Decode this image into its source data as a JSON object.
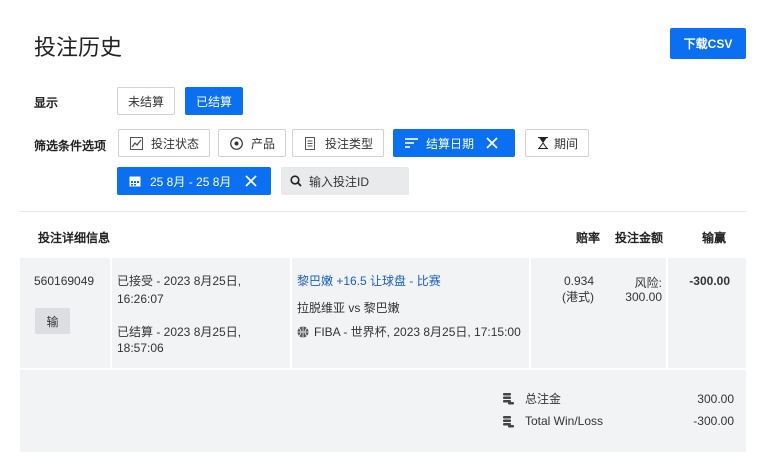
{
  "header": {
    "title": "投注历史",
    "download_label": "下载CSV"
  },
  "display": {
    "label": "显示",
    "unsettled_label": "未结算",
    "settled_label": "已结算"
  },
  "filters": {
    "label": "筛选条件选项",
    "bet_status": "投注状态",
    "product": "产品",
    "bet_type": "投注类型",
    "settle_date": "结算日期",
    "period": "期间",
    "date_range": "25 8月 - 25 8月",
    "search_placeholder": "输入投注ID"
  },
  "table": {
    "headers": {
      "details": "投注详细信息",
      "odds": "赔率",
      "stake": "投注金额",
      "win_loss": "输赢"
    },
    "rows": [
      {
        "bet_id": "560169049",
        "result_badge": "输",
        "accepted_line1": "已接受 - 2023 8月25日,",
        "accepted_line2": "16:26:07",
        "settled_line1": "已结算 - 2023 8月25日,",
        "settled_line2": "18:57:06",
        "selection": "黎巴嫩 +16.5 让球盘 - 比赛",
        "match": "拉脱维亚 vs 黎巴嫩",
        "event": "FIBA - 世界杯, 2023 8月25日, 17:15:00",
        "sport_icon": "basketball-icon",
        "odds_value": "0.934",
        "odds_type": "(港式)",
        "stake_label": "风险:",
        "stake_value": "300.00",
        "win_loss": "-300.00"
      }
    ]
  },
  "summary": {
    "total_stake_label": "总注金",
    "total_stake_value": "300.00",
    "total_wl_label": "Total Win/Loss",
    "total_wl_value": "-300.00"
  },
  "colors": {
    "primary": "#0a6ff0",
    "link": "#1a5fc4",
    "row_bg": "#f2f3f5"
  }
}
